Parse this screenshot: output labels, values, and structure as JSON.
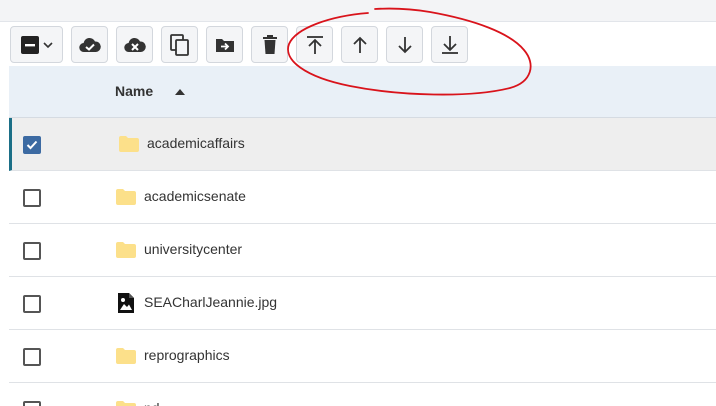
{
  "toolbar": {
    "buttons": [
      {
        "id": "select",
        "icon": "checkbox-minus-icon"
      },
      {
        "id": "check-in",
        "icon": "cloud-check-icon"
      },
      {
        "id": "cancel-checkout",
        "icon": "cloud-x-icon"
      },
      {
        "id": "copy",
        "icon": "copy-icon"
      },
      {
        "id": "move",
        "icon": "folder-move-icon"
      },
      {
        "id": "delete",
        "icon": "trash-icon"
      },
      {
        "id": "move-top",
        "icon": "arrow-up-bar-icon"
      },
      {
        "id": "move-up",
        "icon": "arrow-up-icon"
      },
      {
        "id": "move-down",
        "icon": "arrow-down-icon"
      },
      {
        "id": "move-bottom",
        "icon": "arrow-down-bar-icon"
      }
    ]
  },
  "list": {
    "header": {
      "name": "Name",
      "sort": "ascending"
    },
    "items": [
      {
        "name": "academicaffairs",
        "type": "folder",
        "checked": true
      },
      {
        "name": "academicsenate",
        "type": "folder",
        "checked": false
      },
      {
        "name": "universitycenter",
        "type": "folder",
        "checked": false
      },
      {
        "name": "SEACharlJeannie.jpg",
        "type": "image",
        "checked": false
      },
      {
        "name": "reprographics",
        "type": "folder",
        "checked": false
      },
      {
        "name": "pd",
        "type": "folder",
        "checked": false
      }
    ]
  },
  "colors": {
    "annotation": "#d9131b",
    "folder": "#fce08a",
    "selected_accent": "#1b6f87",
    "header_bg": "#e9f0f7"
  }
}
